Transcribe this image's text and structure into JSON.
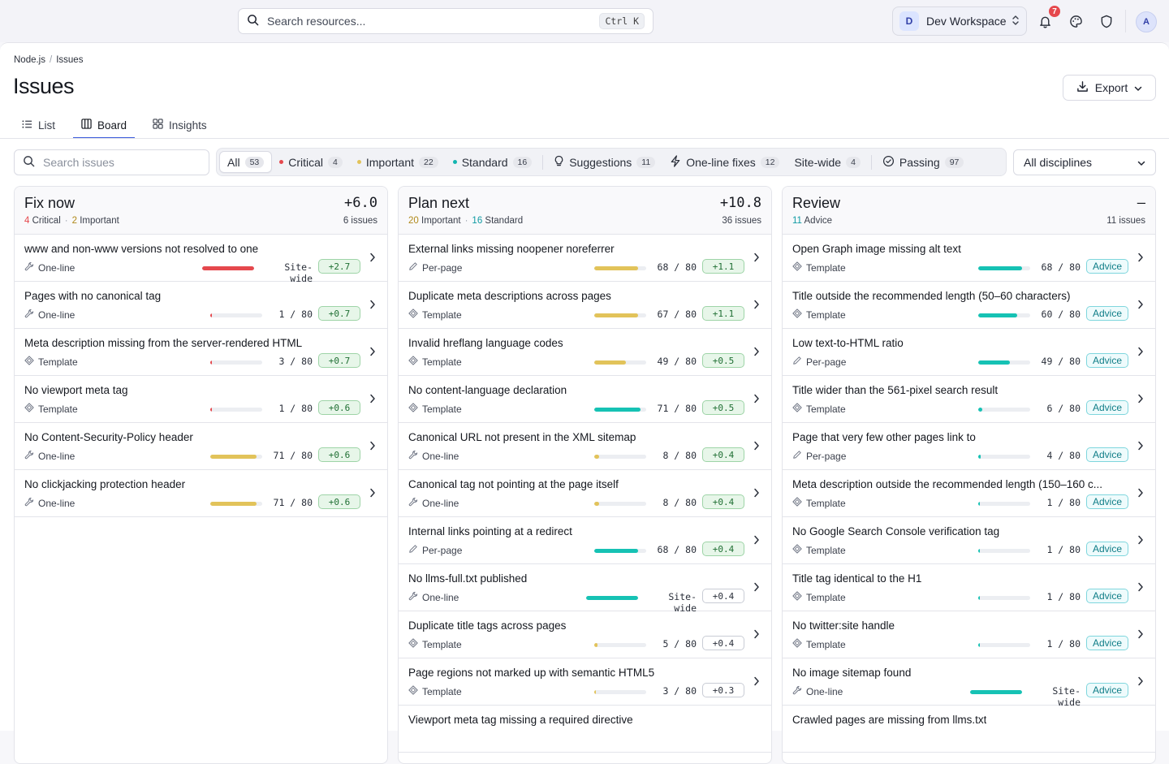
{
  "topbar": {
    "search_placeholder": "Search resources...",
    "search_shortcut": "Ctrl K",
    "workspace_initial": "D",
    "workspace_name": "Dev Workspace",
    "notification_count": "7",
    "avatar_initial": "A"
  },
  "breadcrumb": {
    "parent": "Node.js",
    "current": "Issues"
  },
  "page": {
    "title": "Issues",
    "export_label": "Export"
  },
  "tabs": [
    {
      "label": "List",
      "icon": "list-icon"
    },
    {
      "label": "Board",
      "icon": "board-icon",
      "active": true
    },
    {
      "label": "Insights",
      "icon": "grid-icon"
    }
  ],
  "filters": {
    "search_placeholder": "Search issues",
    "chips": [
      {
        "label": "All",
        "count": "53",
        "active": true
      },
      {
        "label": "Critical",
        "count": "4",
        "dot": "#e5484d"
      },
      {
        "label": "Important",
        "count": "22",
        "dot": "#e2c35a"
      },
      {
        "label": "Standard",
        "count": "16",
        "dot": "#12b5b0"
      },
      {
        "label": "Suggestions",
        "count": "11",
        "icon": "lightbulb-icon"
      },
      {
        "label": "One-line fixes",
        "count": "12",
        "icon": "bolt-icon"
      },
      {
        "label": "Site-wide",
        "count": "4"
      },
      {
        "label": "Passing",
        "count": "97",
        "icon": "check-circle-icon"
      }
    ],
    "discipline_select": "All disciplines"
  },
  "colors": {
    "critical": "#e5484d",
    "important": "#e2c35a",
    "standard": "#16c2b4",
    "accent": "#3b5bdb"
  },
  "columns": [
    {
      "title": "Fix now",
      "score": "+6.0",
      "count": "6 issues",
      "sub": [
        {
          "num": "4",
          "label": "Critical",
          "color": "#e5484d"
        },
        {
          "num": "2",
          "label": "Important",
          "color": "#b0891a"
        }
      ],
      "rows": [
        {
          "title": "www and non-www versions not resolved to one",
          "fix": "One-line",
          "fix_icon": "wrench",
          "level": 1.0,
          "color": "#e5484d",
          "score": "Site-wide",
          "delta": "+2.7",
          "delta_style": "green"
        },
        {
          "title": "Pages with no canonical tag",
          "fix": "One-line",
          "fix_icon": "wrench",
          "level": 0.0125,
          "color": "#e5484d",
          "score": "1 / 80",
          "delta": "+0.7",
          "delta_style": "green"
        },
        {
          "title": "Meta description missing from the server-rendered HTML",
          "fix": "Template",
          "fix_icon": "template",
          "level": 0.0375,
          "color": "#e5484d",
          "score": "3 / 80",
          "delta": "+0.7",
          "delta_style": "green"
        },
        {
          "title": "No viewport meta tag",
          "fix": "Template",
          "fix_icon": "template",
          "level": 0.0125,
          "color": "#e5484d",
          "score": "1 / 80",
          "delta": "+0.6",
          "delta_style": "green"
        },
        {
          "title": "No Content-Security-Policy header",
          "fix": "One-line",
          "fix_icon": "wrench",
          "level": 0.8875,
          "color": "#e2c35a",
          "score": "71 / 80",
          "delta": "+0.6",
          "delta_style": "green"
        },
        {
          "title": "No clickjacking protection header",
          "fix": "One-line",
          "fix_icon": "wrench",
          "level": 0.8875,
          "color": "#e2c35a",
          "score": "71 / 80",
          "delta": "+0.6",
          "delta_style": "green"
        }
      ]
    },
    {
      "title": "Plan next",
      "score": "+10.8",
      "count": "36 issues",
      "sub": [
        {
          "num": "20",
          "label": "Important",
          "color": "#b0891a"
        },
        {
          "num": "16",
          "label": "Standard",
          "color": "#0f9aa3"
        }
      ],
      "rows": [
        {
          "title": "External links missing noopener noreferrer",
          "fix": "Per-page",
          "fix_icon": "pencil",
          "level": 0.85,
          "color": "#e2c35a",
          "score": "68 / 80",
          "delta": "+1.1",
          "delta_style": "green"
        },
        {
          "title": "Duplicate meta descriptions across pages",
          "fix": "Template",
          "fix_icon": "template",
          "level": 0.8375,
          "color": "#e2c35a",
          "score": "67 / 80",
          "delta": "+1.1",
          "delta_style": "green"
        },
        {
          "title": "Invalid hreflang language codes",
          "fix": "Template",
          "fix_icon": "template",
          "level": 0.6125,
          "color": "#e2c35a",
          "score": "49 / 80",
          "delta": "+0.5",
          "delta_style": "green"
        },
        {
          "title": "No content-language declaration",
          "fix": "Template",
          "fix_icon": "template",
          "level": 0.8875,
          "color": "#16c2b4",
          "score": "71 / 80",
          "delta": "+0.5",
          "delta_style": "green"
        },
        {
          "title": "Canonical URL not present in the XML sitemap",
          "fix": "One-line",
          "fix_icon": "wrench",
          "level": 0.1,
          "color": "#e2c35a",
          "score": "8 / 80",
          "delta": "+0.4",
          "delta_style": "green"
        },
        {
          "title": "Canonical tag not pointing at the page itself",
          "fix": "One-line",
          "fix_icon": "wrench",
          "level": 0.1,
          "color": "#e2c35a",
          "score": "8 / 80",
          "delta": "+0.4",
          "delta_style": "green"
        },
        {
          "title": "Internal links pointing at a redirect",
          "fix": "Per-page",
          "fix_icon": "pencil",
          "level": 0.85,
          "color": "#16c2b4",
          "score": "68 / 80",
          "delta": "+0.4",
          "delta_style": "green"
        },
        {
          "title": "No llms-full.txt published",
          "fix": "One-line",
          "fix_icon": "wrench",
          "level": 1.0,
          "color": "#16c2b4",
          "score": "Site-wide",
          "delta": "+0.4",
          "delta_style": "plain"
        },
        {
          "title": "Duplicate title tags across pages",
          "fix": "Template",
          "fix_icon": "template",
          "level": 0.0625,
          "color": "#e2c35a",
          "score": "5 / 80",
          "delta": "+0.4",
          "delta_style": "plain"
        },
        {
          "title": "Page regions not marked up with semantic HTML5",
          "fix": "Template",
          "fix_icon": "template",
          "level": 0.0375,
          "color": "#e2c35a",
          "score": "3 / 80",
          "delta": "+0.3",
          "delta_style": "plain"
        },
        {
          "title": "Viewport meta tag missing a required directive",
          "fix": "",
          "fix_icon": "",
          "level": 0,
          "color": "#e2c35a",
          "score": "",
          "delta": "",
          "delta_style": "plain"
        }
      ]
    },
    {
      "title": "Review",
      "score": "–",
      "count": "11 issues",
      "sub": [
        {
          "num": "11",
          "label": "Advice",
          "color": "#0f9aa3"
        }
      ],
      "rows": [
        {
          "title": "Open Graph image missing alt text",
          "fix": "Template",
          "fix_icon": "template",
          "level": 0.85,
          "color": "#16c2b4",
          "score": "68 / 80",
          "delta": "Advice",
          "delta_style": "advice"
        },
        {
          "title": "Title outside the recommended length (50–60 characters)",
          "fix": "Template",
          "fix_icon": "template",
          "level": 0.75,
          "color": "#16c2b4",
          "score": "60 / 80",
          "delta": "Advice",
          "delta_style": "advice"
        },
        {
          "title": "Low text-to-HTML ratio",
          "fix": "Per-page",
          "fix_icon": "pencil",
          "level": 0.6125,
          "color": "#16c2b4",
          "score": "49 / 80",
          "delta": "Advice",
          "delta_style": "advice"
        },
        {
          "title": "Title wider than the 561-pixel search result",
          "fix": "Template",
          "fix_icon": "template",
          "level": 0.075,
          "color": "#16c2b4",
          "score": "6 / 80",
          "delta": "Advice",
          "delta_style": "advice"
        },
        {
          "title": "Page that very few other pages link to",
          "fix": "Per-page",
          "fix_icon": "pencil",
          "level": 0.05,
          "color": "#16c2b4",
          "score": "4 / 80",
          "delta": "Advice",
          "delta_style": "advice"
        },
        {
          "title": "Meta description outside the recommended length (150–160 c...",
          "fix": "Template",
          "fix_icon": "template",
          "level": 0.0125,
          "color": "#16c2b4",
          "score": "1 / 80",
          "delta": "Advice",
          "delta_style": "advice"
        },
        {
          "title": "No Google Search Console verification tag",
          "fix": "Template",
          "fix_icon": "template",
          "level": 0.0125,
          "color": "#16c2b4",
          "score": "1 / 80",
          "delta": "Advice",
          "delta_style": "advice"
        },
        {
          "title": "Title tag identical to the H1",
          "fix": "Template",
          "fix_icon": "template",
          "level": 0.0125,
          "color": "#16c2b4",
          "score": "1 / 80",
          "delta": "Advice",
          "delta_style": "advice"
        },
        {
          "title": "No twitter:site handle",
          "fix": "Template",
          "fix_icon": "template",
          "level": 0.0125,
          "color": "#16c2b4",
          "score": "1 / 80",
          "delta": "Advice",
          "delta_style": "advice"
        },
        {
          "title": "No image sitemap found",
          "fix": "One-line",
          "fix_icon": "wrench",
          "level": 1.0,
          "color": "#16c2b4",
          "score": "Site-wide",
          "delta": "Advice",
          "delta_style": "advice"
        },
        {
          "title": "Crawled pages are missing from llms.txt",
          "fix": "",
          "fix_icon": "",
          "level": 0,
          "color": "#16c2b4",
          "score": "",
          "delta": "",
          "delta_style": "advice"
        }
      ]
    }
  ]
}
